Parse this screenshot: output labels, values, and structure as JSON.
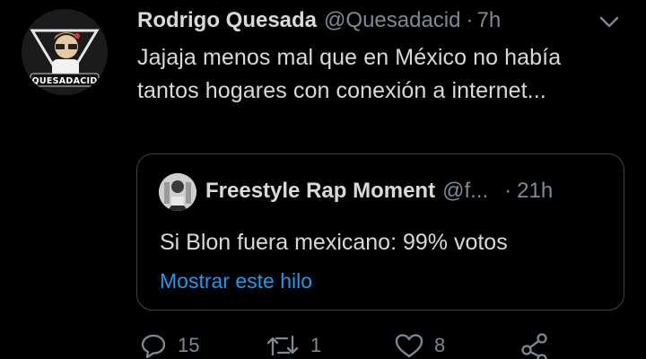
{
  "tweet": {
    "author": {
      "name": "Rodrigo Quesada",
      "handle": "@Quesadacid",
      "avatar_label": "QUESADACID"
    },
    "separator": "·",
    "time": "7h",
    "text": "Jajaja menos mal que en México no había tantos hogares con conexión a internet...",
    "menu_icon": "chevron-down-icon"
  },
  "quoted": {
    "name": "Freestyle Rap Moment",
    "handle": "@f...",
    "separator": "·",
    "time": "21h",
    "text": "Si Blon fuera mexicano: 99% votos",
    "show_thread": "Mostrar este hilo"
  },
  "actions": {
    "reply_count": "15",
    "retweet_count": "1",
    "like_count": "8",
    "icons": [
      "reply-icon",
      "retweet-icon",
      "like-icon",
      "share-icon"
    ]
  },
  "colors": {
    "background": "#000000",
    "text": "#d9d9d9",
    "secondary": "#7c8a96",
    "link": "#1d9bf0",
    "border": "#3a444c"
  }
}
